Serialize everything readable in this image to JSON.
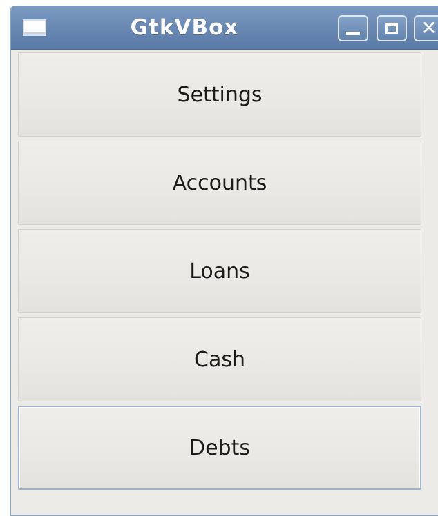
{
  "window": {
    "title": "GtkVBox",
    "controls": {
      "minimize": "minimize",
      "maximize": "maximize",
      "close": "✕"
    }
  },
  "buttons": [
    {
      "label": "Settings"
    },
    {
      "label": "Accounts"
    },
    {
      "label": "Loans"
    },
    {
      "label": "Cash"
    },
    {
      "label": "Debts"
    }
  ],
  "colors": {
    "titlebar": "#6b8bb5",
    "window_bg": "#edebe7",
    "focus_border": "#9fb4cc"
  }
}
